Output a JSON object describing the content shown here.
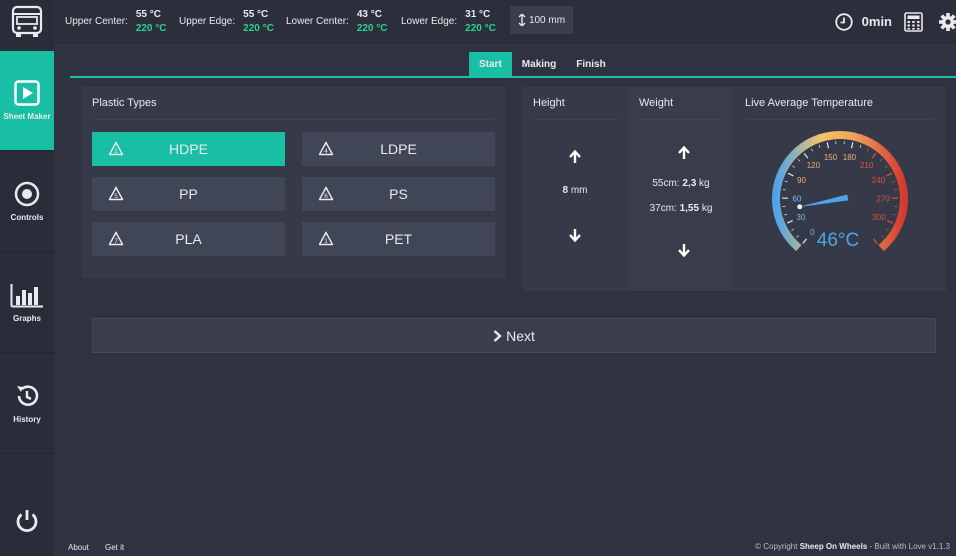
{
  "sidebar": {
    "items": [
      {
        "label": "Sheet Maker",
        "icon": "play-icon",
        "active": true
      },
      {
        "label": "Controls",
        "icon": "target-icon",
        "active": false
      },
      {
        "label": "Graphs",
        "icon": "bar-chart-icon",
        "active": false
      },
      {
        "label": "History",
        "icon": "history-icon",
        "active": false
      }
    ],
    "logo_icon": "bus-icon",
    "power_icon": "power-icon"
  },
  "header": {
    "sensors": [
      {
        "label": "Upper Center:",
        "current": "55 °C",
        "setpoint": "220 °C"
      },
      {
        "label": "Upper Edge:",
        "current": "55 °C",
        "setpoint": "220 °C"
      },
      {
        "label": "Lower Center:",
        "current": "43 °C",
        "setpoint": "220 °C"
      },
      {
        "label": "Lower Edge:",
        "current": "31 °C",
        "setpoint": "220 °C"
      }
    ],
    "thickness": "100 mm",
    "time": "0min"
  },
  "tabs": [
    {
      "label": "Start",
      "active": true
    },
    {
      "label": "Making",
      "active": false
    },
    {
      "label": "Finish",
      "active": false
    }
  ],
  "plastic": {
    "title": "Plastic Types",
    "types": [
      "HDPE",
      "LDPE",
      "PP",
      "PS",
      "PLA",
      "PET"
    ],
    "selected": "HDPE"
  },
  "height": {
    "title": "Height",
    "value": "8",
    "unit": " mm"
  },
  "weight": {
    "title": "Weight",
    "rows": [
      {
        "prefix": "55cm: ",
        "value": "2,3",
        "unit": " kg"
      },
      {
        "prefix": "37cm: ",
        "value": "1,55",
        "unit": " kg"
      }
    ]
  },
  "gauge": {
    "title": "Live Average Temperature",
    "value": 46,
    "value_text": "46°C",
    "min": 0,
    "max": 330,
    "ticks": [
      "0",
      "30",
      "60",
      "90",
      "120",
      "150",
      "180",
      "210",
      "240",
      "270",
      "300"
    ]
  },
  "next_label": "Next",
  "footer": {
    "about": "About",
    "get_it": "Get it",
    "copyright_prefix": "© Copyright ",
    "brand": "Sheep On Wheels",
    "copyright_suffix": " - Built with Love v1.1.3"
  }
}
